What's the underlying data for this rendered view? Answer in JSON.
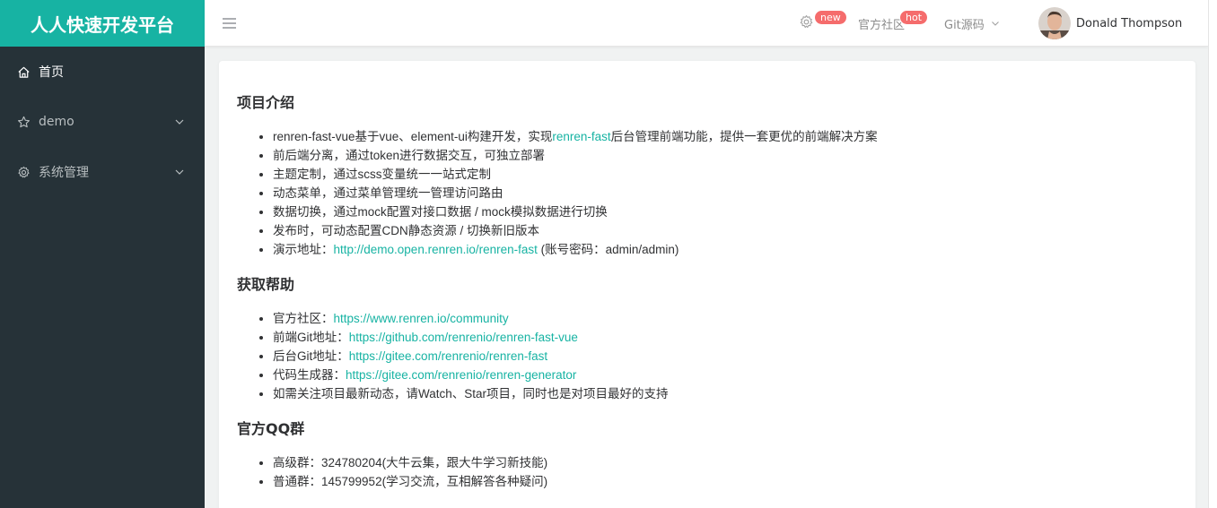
{
  "brand": {
    "title": "人人快速开发平台"
  },
  "sidebar": {
    "items": [
      {
        "label": "首页",
        "icon": "home-icon"
      },
      {
        "label": "demo",
        "icon": "star-icon"
      },
      {
        "label": "系统管理",
        "icon": "gear-icon"
      }
    ]
  },
  "header": {
    "settings_badge": "new",
    "community_label": "官方社区",
    "community_badge": "hot",
    "git_label": "Git源码",
    "user_name": "Donald Thompson"
  },
  "content": {
    "sections": [
      {
        "title": "项目介绍",
        "items": [
          {
            "pre": "renren-fast-vue基于vue、element-ui构建开发，实现",
            "link": "renren-fast",
            "post": "后台管理前端功能，提供一套更优的前端解决方案"
          },
          {
            "pre": "前后端分离，通过token进行数据交互，可独立部署"
          },
          {
            "pre": "主题定制，通过scss变量统一一站式定制"
          },
          {
            "pre": "动态菜单，通过菜单管理统一管理访问路由"
          },
          {
            "pre": "数据切换，通过mock配置对接口数据 / mock模拟数据进行切换"
          },
          {
            "pre": "发布时，可动态配置CDN静态资源 / 切换新旧版本"
          },
          {
            "pre": "演示地址：",
            "link": "http://demo.open.renren.io/renren-fast",
            "post": " (账号密码：admin/admin)"
          }
        ]
      },
      {
        "title": "获取帮助",
        "items": [
          {
            "pre": "官方社区：",
            "link": "https://www.renren.io/community"
          },
          {
            "pre": "前端Git地址：",
            "link": "https://github.com/renrenio/renren-fast-vue"
          },
          {
            "pre": "后台Git地址：",
            "link": "https://gitee.com/renrenio/renren-fast"
          },
          {
            "pre": "代码生成器：",
            "link": "https://gitee.com/renrenio/renren-generator"
          },
          {
            "pre": "如需关注项目最新动态，请Watch、Star项目，同时也是对项目最好的支持"
          }
        ]
      },
      {
        "title": "官方QQ群",
        "items": [
          {
            "pre": "高级群：324780204(大牛云集，跟大牛学习新技能)"
          },
          {
            "pre": "普通群：145799952(学习交流，互相解答各种疑问)"
          }
        ]
      }
    ]
  }
}
